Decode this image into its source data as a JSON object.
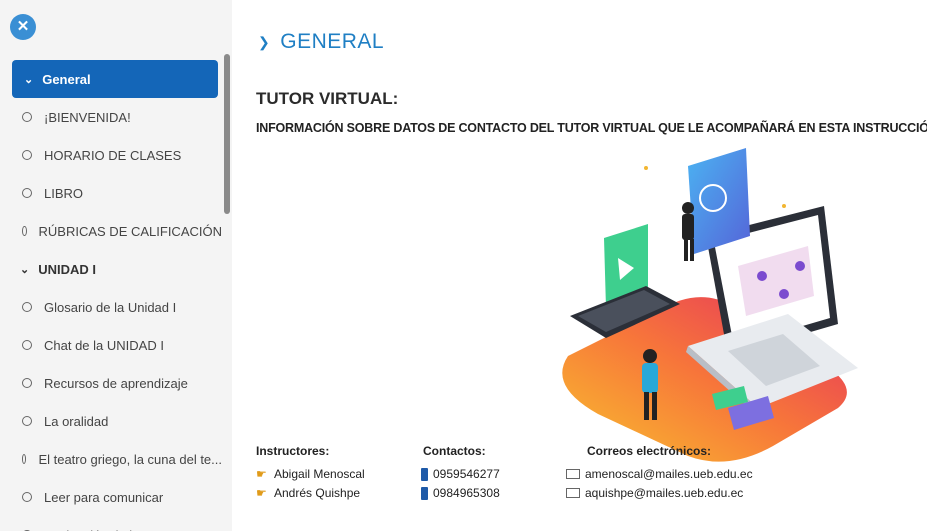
{
  "sidebar": {
    "close_icon": "close-icon",
    "items": [
      {
        "label": "General",
        "kind": "active"
      },
      {
        "label": "¡BIENVENIDA!",
        "kind": "item"
      },
      {
        "label": "HORARIO DE CLASES",
        "kind": "item"
      },
      {
        "label": "LIBRO",
        "kind": "item"
      },
      {
        "label": "RÚBRICAS DE CALIFICACIÓN",
        "kind": "item"
      },
      {
        "label": "UNIDAD I",
        "kind": "section"
      },
      {
        "label": "Glosario de la Unidad I",
        "kind": "item"
      },
      {
        "label": "Chat de la UNIDAD I",
        "kind": "item"
      },
      {
        "label": "Recursos de aprendizaje",
        "kind": "item"
      },
      {
        "label": "La oralidad",
        "kind": "item"
      },
      {
        "label": "El teatro griego, la cuna del te...",
        "kind": "item"
      },
      {
        "label": "Leer para comunicar",
        "kind": "item"
      },
      {
        "label": "Evaluación de la UNIDAD I",
        "kind": "item"
      }
    ]
  },
  "main": {
    "section_title": "GENERAL",
    "tutor_title": "TUTOR VIRTUAL:",
    "tutor_subtitle": "INFORMACIÓN SOBRE DATOS DE CONTACTO DEL TUTOR VIRTUAL QUE LE ACOMPAÑARÁ EN ESTA INSTRUCCIÓN:",
    "contacts": {
      "headers": {
        "instructors": "Instructores:",
        "phones": "Contactos:",
        "emails": "Correos electrónicos:"
      },
      "rows": [
        {
          "name": "Abigail Menoscal",
          "phone": "0959546277",
          "email": "amenoscal@mailes.ueb.edu.ec"
        },
        {
          "name": "Andrés Quishpe",
          "phone": "0984965308",
          "email": "aquishpe@mailes.ueb.edu.ec"
        }
      ]
    }
  },
  "colors": {
    "accent": "#1466b8",
    "title_blue": "#1f7fc4",
    "close_button": "#3a8fd4"
  }
}
